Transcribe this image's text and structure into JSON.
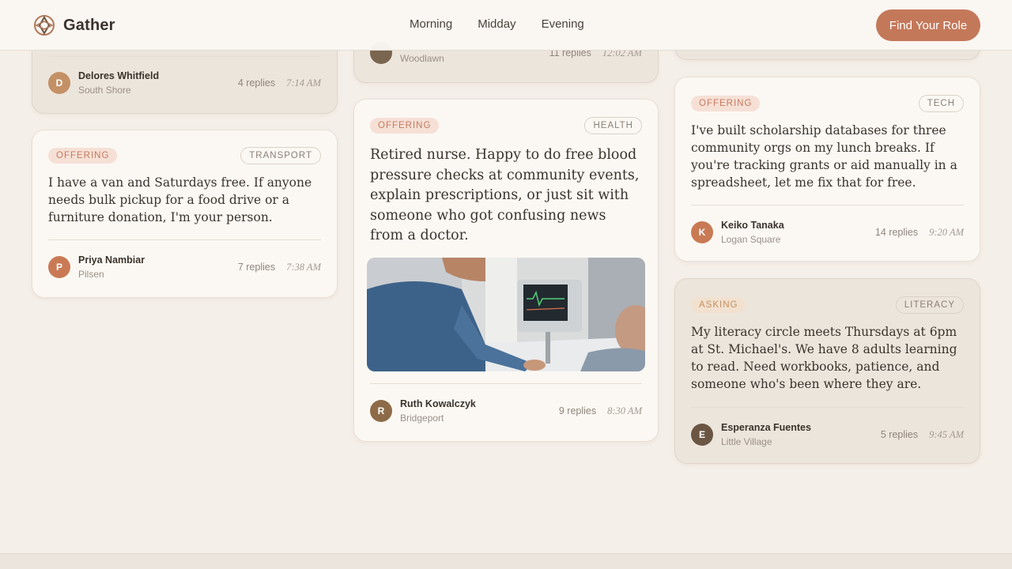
{
  "brand": {
    "name": "Gather"
  },
  "nav": [
    "Morning",
    "Midday",
    "Evening"
  ],
  "cta": "Find Your Role",
  "colors": {
    "accent": "#c4785a",
    "page_bg": "#f5efe9"
  },
  "cards": [
    {
      "partial_top": true,
      "name": "Delores Whitfield",
      "initial": "D",
      "location": "South Shore",
      "replies": "4 replies",
      "time": "7:14 AM",
      "avatar_color": "#c49065"
    },
    {
      "tag": "OFFERING",
      "category": "TRANSPORT",
      "text": "I have a van and Saturdays free. If anyone needs bulk pickup for a food drive or a furniture donation, I'm your person.",
      "name": "Priya Nambiar",
      "initial": "P",
      "location": "Pilsen",
      "replies": "7 replies",
      "time": "7:38 AM",
      "avatar_color": "#c97a55"
    },
    {
      "partial_top": true,
      "location": "Woodlawn",
      "replies": "11 replies",
      "time": "12:02 AM",
      "avatar_color": "#7a6550"
    },
    {
      "tag": "OFFERING",
      "category": "HEALTH",
      "text": "Retired nurse. Happy to do free blood pressure checks at community events, explain prescriptions, or just sit with someone who got confusing news from a doctor.",
      "name": "Ruth Kowalczyk",
      "initial": "R",
      "location": "Bridgeport",
      "replies": "9 replies",
      "time": "8:30 AM",
      "avatar_color": "#8d6b48",
      "image": "nurse-checking-patient-photo"
    },
    {
      "tag": "OFFERING",
      "category": "TECH",
      "text": "I've built scholarship databases for three community orgs on my lunch breaks. If you're tracking grants or aid manually in a spreadsheet, let me fix that for free.",
      "name": "Keiko Tanaka",
      "initial": "K",
      "location": "Logan Square",
      "replies": "14 replies",
      "time": "9:20 AM",
      "avatar_color": "#c97a55"
    },
    {
      "tag": "ASKING",
      "category": "LITERACY",
      "text": "My literacy circle meets Thursdays at 6pm at St. Michael's. We have 8 adults learning to read. Need workbooks, patience, and someone who's been where they are.",
      "name": "Esperanza Fuentes",
      "initial": "E",
      "location": "Little Village",
      "replies": "5 replies",
      "time": "9:45 AM",
      "avatar_color": "#6b5644"
    }
  ]
}
